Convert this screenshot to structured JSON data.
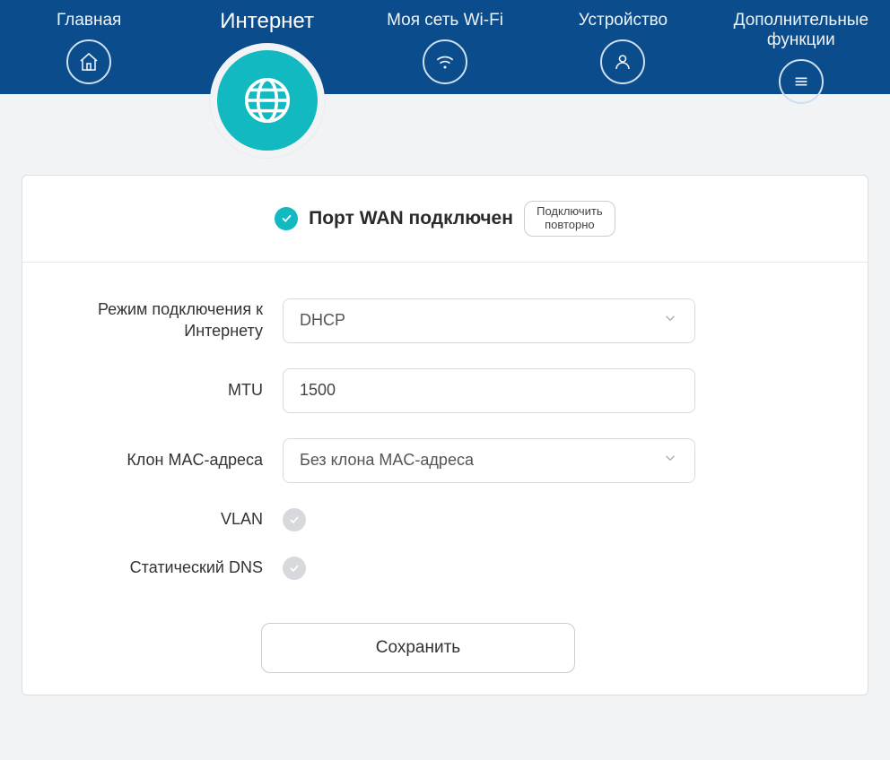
{
  "nav": {
    "home": {
      "label": "Главная"
    },
    "internet": {
      "label": "Интернет"
    },
    "wifi": {
      "label": "Моя сеть Wi-Fi"
    },
    "device": {
      "label": "Устройство"
    },
    "extra": {
      "label": "Дополнительные функции"
    }
  },
  "status": {
    "text": "Порт WAN подключен",
    "reconnect": "Подключить повторно"
  },
  "form": {
    "mode_label": "Режим подключения к Интернету",
    "mode_value": "DHCP",
    "mtu_label": "MTU",
    "mtu_value": "1500",
    "mac_label": "Клон MAC-адреса",
    "mac_value": "Без клона MAC-адреса",
    "vlan_label": "VLAN",
    "dns_label": "Статический DNS",
    "save": "Сохранить"
  }
}
